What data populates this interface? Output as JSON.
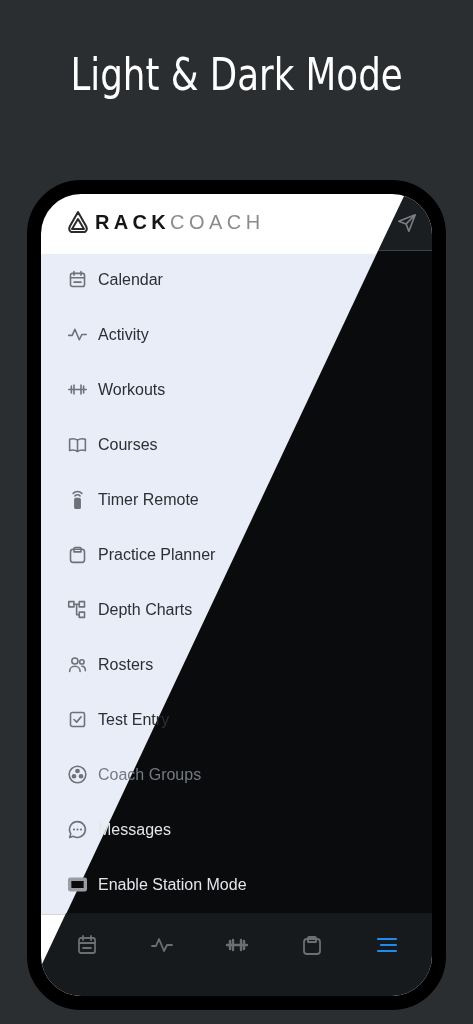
{
  "title": "Light & Dark Mode",
  "brand": {
    "primary": "RACK",
    "secondary": "COACH"
  },
  "menu": [
    {
      "kind": "calendar",
      "label": "Calendar"
    },
    {
      "kind": "activity",
      "label": "Activity"
    },
    {
      "kind": "workouts",
      "label": "Workouts"
    },
    {
      "kind": "courses",
      "label": "Courses"
    },
    {
      "kind": "remote",
      "label": "Timer Remote"
    },
    {
      "kind": "planner",
      "label": "Practice Planner"
    },
    {
      "kind": "depth",
      "label": "Depth Charts"
    },
    {
      "kind": "rosters",
      "label": "Rosters"
    },
    {
      "kind": "test",
      "label": "Test Entry"
    },
    {
      "kind": "groups",
      "label": "Coach Groups"
    },
    {
      "kind": "messages",
      "label": "Messages"
    },
    {
      "kind": "station",
      "label": "Enable Station Mode"
    }
  ],
  "tabs": [
    {
      "kind": "calendar",
      "selected": false
    },
    {
      "kind": "activity",
      "selected": false
    },
    {
      "kind": "workouts",
      "selected": false
    },
    {
      "kind": "planner",
      "selected": false
    },
    {
      "kind": "menu",
      "selected": true
    }
  ]
}
